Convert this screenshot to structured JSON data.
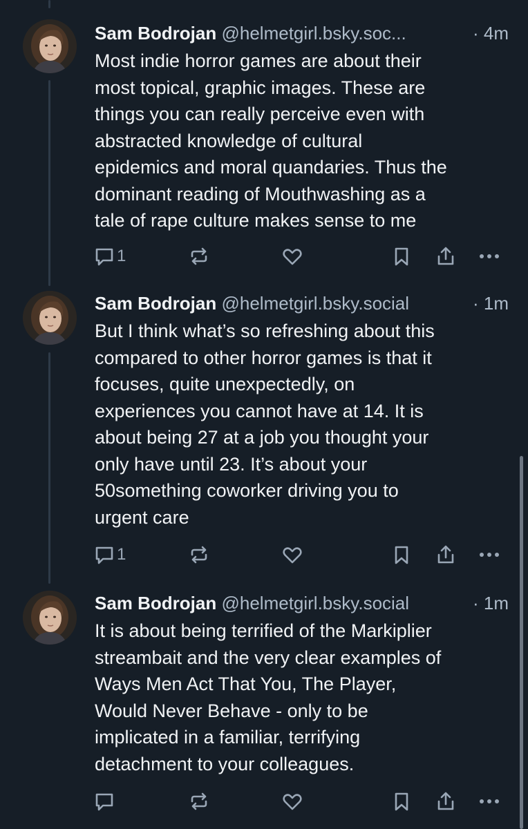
{
  "theme": {
    "background": "#161e27",
    "text": "#f1f3f5",
    "muted": "#aebbc9",
    "thread_line": "#2e3a48"
  },
  "posts": [
    {
      "author": "Sam Bodrojan",
      "handle": "@helmetgirl.bsky.soc...",
      "time": "· 4m",
      "text": "Most indie horror games are about their\nmost topical, graphic images. These are\nthings you can really perceive even with\nabstracted knowledge of cultural\nepidemics and moral quandaries. Thus the\ndominant reading of Mouthwashing as a\ntale of rape culture makes sense to me",
      "reply_count": "1",
      "icons": [
        "reply-icon",
        "repost-icon",
        "like-icon",
        "bookmark-icon",
        "share-icon",
        "more-icon"
      ]
    },
    {
      "author": "Sam Bodrojan",
      "handle": "@helmetgirl.bsky.social",
      "time": "· 1m",
      "text": "But I think what’s so refreshing about this\ncompared to other horror games is that it\nfocuses, quite unexpectedly, on\nexperiences you cannot have at 14.  It is\nabout being 27 at a job you thought your\nonly have until 23. It’s about your\n50something coworker driving you to\nurgent care",
      "reply_count": "1",
      "icons": [
        "reply-icon",
        "repost-icon",
        "like-icon",
        "bookmark-icon",
        "share-icon",
        "more-icon"
      ]
    },
    {
      "author": "Sam Bodrojan",
      "handle": "@helmetgirl.bsky.social",
      "time": "· 1m",
      "text": "It is about being terrified of the Markiplier\nstreambait and the very clear examples of\nWays Men Act That You, The Player,\nWould Never Behave - only to be\nimplicated in a familiar, terrifying\ndetachment to your colleagues.",
      "reply_count": "",
      "icons": [
        "reply-icon",
        "repost-icon",
        "like-icon",
        "bookmark-icon",
        "share-icon",
        "more-icon"
      ]
    }
  ]
}
